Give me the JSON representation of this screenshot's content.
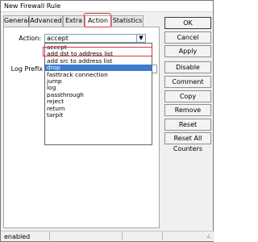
{
  "window": {
    "title": "New Firewall Rule"
  },
  "tabs": [
    {
      "label": "General"
    },
    {
      "label": "Advanced"
    },
    {
      "label": "Extra"
    },
    {
      "label": "Action"
    },
    {
      "label": "Statistics"
    }
  ],
  "form": {
    "action_label": "Action:",
    "action_value": "accept",
    "log_prefix_label": "Log Prefix"
  },
  "dropdown": {
    "options": [
      "accept",
      "add dst to address list",
      "add src to address list",
      "drop",
      "fasttrack connection",
      "jump",
      "log",
      "passthrough",
      "reject",
      "return",
      "tarpit"
    ],
    "selected_index": 3
  },
  "buttons": {
    "ok": "OK",
    "cancel": "Cancel",
    "apply": "Apply",
    "disable": "Disable",
    "comment": "Comment",
    "copy": "Copy",
    "remove": "Remove",
    "reset_counters": "Reset Counters",
    "reset_all_counters": "Reset All Counters"
  },
  "status": {
    "text": "enabled"
  },
  "icons": {
    "select_arrow": "dropdown-arrow-icon",
    "resize": "resize-grip-icon"
  },
  "colors": {
    "selection": "#3d7bcf",
    "highlight": "#e03040"
  }
}
